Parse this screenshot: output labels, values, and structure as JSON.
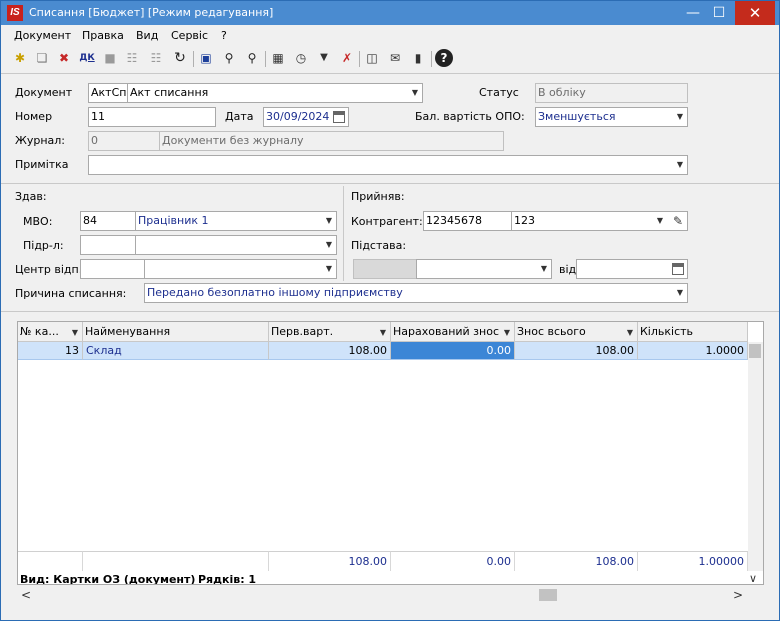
{
  "window": {
    "title": "Списання [Бюджет] [Режим редагування]",
    "logo": "IS"
  },
  "menu": [
    "Документ",
    "Правка",
    "Вид",
    "Сервіс",
    "?"
  ],
  "toolbar": {
    "dk_label": "ДК"
  },
  "form": {
    "document_label": "Документ",
    "document_code": "АктСп",
    "document_name": "Акт списання",
    "status_label": "Статус",
    "status_value": "В обліку",
    "number_label": "Номер",
    "number_value": "11",
    "date_label": "Дата",
    "date_value": "30/09/2024",
    "balance_label": "Бал. вартість ОПО:",
    "balance_value": "Зменшується",
    "journal_label": "Журнал:",
    "journal_code": "0",
    "journal_name": "Документи без журналу",
    "note_label": "Примітка",
    "note_value": "",
    "handed_header": "Здав:",
    "mvo_label": "МВО:",
    "mvo_code": "84",
    "mvo_name": "Працівник 1",
    "dept_label": "Підр-л:",
    "dept_code": "",
    "dept_name": "",
    "center_label": "Центр відп.:",
    "center_code": "",
    "center_name": "",
    "received_header": "Прийняв:",
    "counterparty_label": "Контрагент:",
    "counterparty_code": "12345678",
    "counterparty_name": "123",
    "basis_label": "Підстава:",
    "basis_code": "",
    "basis_name": "",
    "from_label": "від",
    "from_value": "",
    "reason_label": "Причина списання:",
    "reason_value": "Передано безоплатно іншому підприємству"
  },
  "grid": {
    "columns": [
      "№ ка...",
      "Найменування",
      "Перв.варт.",
      "Нарахований знос",
      "Знос всього",
      "Кількість"
    ],
    "rows": [
      {
        "no": "13",
        "name": "Склад",
        "initial": "108.00",
        "accrued": "0.00",
        "total_wear": "108.00",
        "qty": "1.0000"
      }
    ],
    "totals": {
      "initial": "108.00",
      "accrued": "0.00",
      "total_wear": "108.00",
      "qty": "1.00000"
    }
  },
  "status": {
    "view": "Вид: Картки ОЗ (документ)",
    "rows": "Рядків: 1"
  }
}
